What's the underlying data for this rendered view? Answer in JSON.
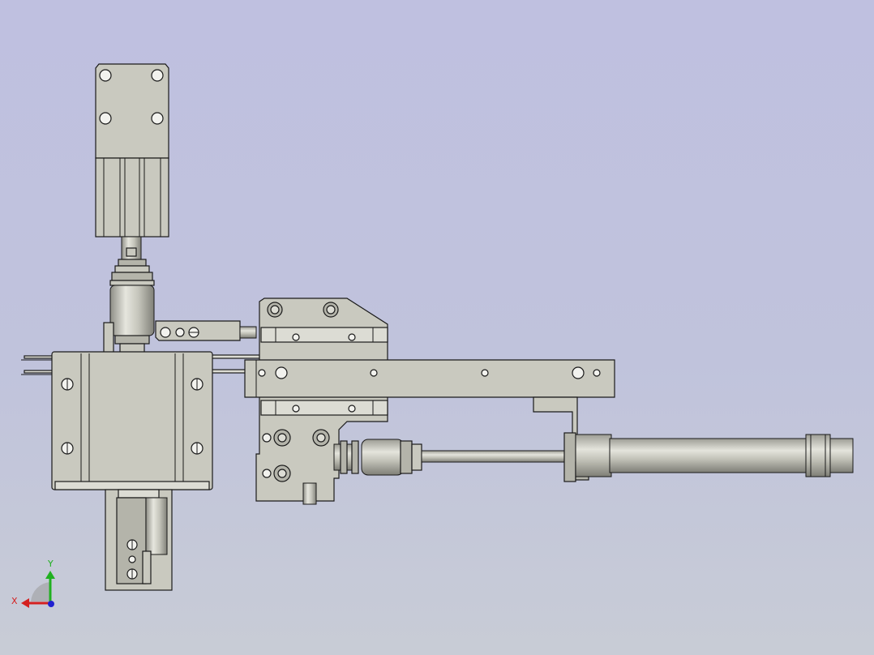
{
  "view": {
    "background_top": "#bfc0e0",
    "background_bottom": "#c8ccd6",
    "part_color": "#c9c9bf",
    "edge_color": "#1a1a1a"
  },
  "triad": {
    "x_label": "X",
    "y_label": "Y",
    "x_color": "#d42020",
    "y_color": "#20b020",
    "z_color": "#2020d0"
  }
}
